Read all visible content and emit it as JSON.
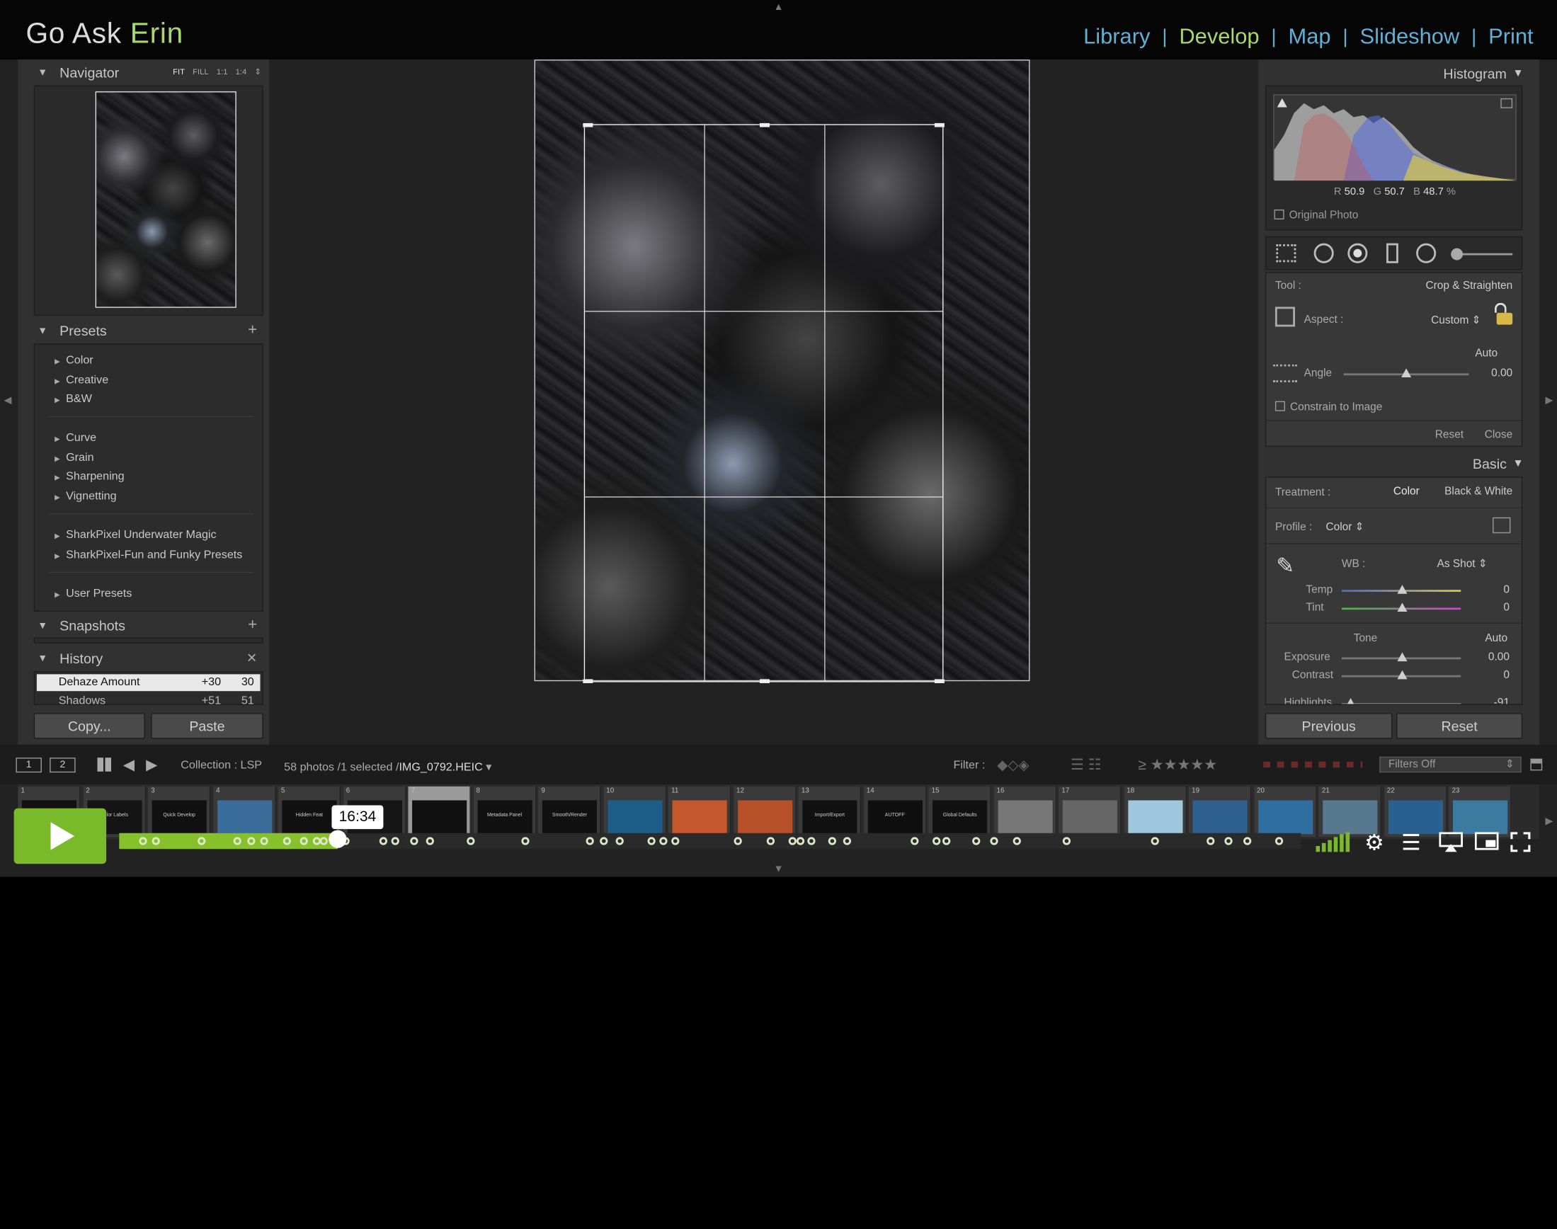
{
  "identity": {
    "prefix": "Go Ask ",
    "highlight": "Erin"
  },
  "modules": [
    {
      "label": "Library",
      "active": false
    },
    {
      "label": "Develop",
      "active": true
    },
    {
      "label": "Map",
      "active": false
    },
    {
      "label": "Slideshow",
      "active": false
    },
    {
      "label": "Print",
      "active": false
    }
  ],
  "module_separator": "|",
  "navigator": {
    "title": "Navigator",
    "zoom": [
      "FIT",
      "FILL",
      "1:1",
      "1:4"
    ]
  },
  "presets": {
    "title": "Presets",
    "groups": [
      [
        "Color",
        "Creative",
        "B&W"
      ],
      [
        "Curve",
        "Grain",
        "Sharpening",
        "Vignetting"
      ],
      [
        "SharkPixel Underwater Magic",
        "SharkPixel-Fun and Funky Presets"
      ],
      [
        "User Presets"
      ]
    ]
  },
  "snapshots": {
    "title": "Snapshots"
  },
  "history": {
    "title": "History",
    "items": [
      {
        "label": "Dehaze Amount",
        "delta": "+30",
        "value": "30"
      },
      {
        "label": "Shadows",
        "delta": "+51",
        "value": "51"
      }
    ]
  },
  "left_buttons": {
    "copy": "Copy...",
    "paste": "Paste"
  },
  "histogram": {
    "title": "Histogram",
    "readout": {
      "r_label": "R",
      "r": "50.9",
      "g_label": "G",
      "g": "50.7",
      "b_label": "B",
      "b": "48.7",
      "unit": "%"
    },
    "original_photo": "Original Photo"
  },
  "crop": {
    "tool_label": "Tool :",
    "tool_value": "Crop & Straighten",
    "aspect_label": "Aspect :",
    "aspect_value": "Custom",
    "auto": "Auto",
    "angle_label": "Angle",
    "angle_value": "0.00",
    "constrain": "Constrain to Image",
    "reset": "Reset",
    "close": "Close"
  },
  "basic": {
    "title": "Basic",
    "treatment_label": "Treatment :",
    "treatment_color": "Color",
    "treatment_bw": "Black & White",
    "profile_label": "Profile :",
    "profile_value": "Color",
    "wb_label": "WB :",
    "wb_value": "As Shot",
    "temp_label": "Temp",
    "temp_value": "0",
    "tint_label": "Tint",
    "tint_value": "0",
    "tone_label": "Tone",
    "tone_auto": "Auto",
    "exposure_label": "Exposure",
    "exposure_value": "0.00",
    "contrast_label": "Contrast",
    "contrast_value": "0",
    "highlights_label": "Highlights",
    "highlights_value": "-91"
  },
  "right_buttons": {
    "previous": "Previous",
    "reset": "Reset"
  },
  "filmbar": {
    "screen1": "1",
    "screen2": "2",
    "collection": "Collection : LSP",
    "count": "58 photos /1 selected /",
    "filename": "IMG_0792.HEIC",
    "filter_label": "Filter :",
    "stars_prefix": "≥",
    "filters_off": "Filters Off"
  },
  "filmstrip": {
    "numbers": [
      "1",
      "2",
      "3",
      "4",
      "5",
      "6",
      "7",
      "8",
      "9",
      "10",
      "11",
      "12",
      "13",
      "14",
      "15",
      "16",
      "17",
      "18",
      "19",
      "20",
      "21",
      "22",
      "23"
    ],
    "labels": [
      "",
      "Color Labels",
      "Quick Develop",
      "",
      "Hidden Feat",
      "",
      "",
      "Metadata Panel",
      "Smooth/Render",
      "",
      "",
      "",
      "Import/Export",
      "AUTOFF",
      "Global Defaults",
      "",
      "",
      "",
      "",
      "",
      "",
      "",
      ""
    ],
    "selected_index": 6
  },
  "video": {
    "time": "16:34",
    "progress": 0.185
  }
}
